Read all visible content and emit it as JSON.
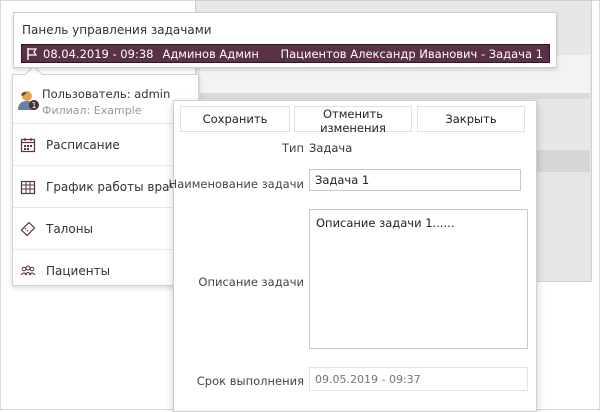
{
  "task_panel": {
    "title": "Панель управления задачами",
    "task": {
      "date": "08.04.2019 - 09:38",
      "author": "Админов Админ",
      "patient_task": "Пациентов Александр Иванович - Задача 1"
    }
  },
  "user": {
    "label": "Пользователь: admin",
    "branch": "Филиал: Example",
    "badge": "1"
  },
  "nav": {
    "items": [
      {
        "label": "Расписание",
        "icon": "calendar-icon"
      },
      {
        "label": "График работы врачей",
        "icon": "schedule-grid-icon"
      },
      {
        "label": "Талоны",
        "icon": "ticket-icon"
      },
      {
        "label": "Пациенты",
        "icon": "people-icon"
      }
    ]
  },
  "editor": {
    "buttons": {
      "save": "Сохранить",
      "cancel": "Отменить изменения",
      "close": "Закрыть"
    },
    "labels": {
      "type": "Тип",
      "name": "Наименование задачи",
      "description": "Описание задачи",
      "due": "Срок выполнения"
    },
    "values": {
      "type": "Задача",
      "name": "Задача 1",
      "description": "Описание задачи 1......",
      "due": "09.05.2019 - 09:37"
    }
  },
  "colors": {
    "task_row_bg": "#5b3147",
    "nav_icon": "#5b3147",
    "avatar_badge": "#4a2d3b"
  }
}
